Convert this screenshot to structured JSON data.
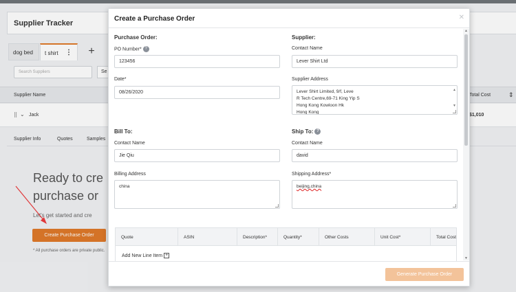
{
  "app": {
    "title": "Supplier Tracker",
    "tabs": [
      {
        "label": "dog bed"
      },
      {
        "label": "t shirt"
      }
    ],
    "add_tab_label": "+",
    "search": {
      "placeholder": "Search Suppliers",
      "button_label": "Se"
    },
    "table": {
      "columns": [
        "Supplier Name",
        "Total Cost"
      ],
      "rows": [
        {
          "name": "Jack",
          "total": "$1,010"
        }
      ]
    },
    "subtabs": [
      "Supplier Info",
      "Quotes",
      "Samples"
    ],
    "empty_state": {
      "heading_line1": "Ready to cre",
      "heading_line2": "purchase or",
      "subtext": "Let's get started and cre",
      "button_label": "Create Purchase Order",
      "note": "* All purchase orders are private public."
    }
  },
  "modal": {
    "title": "Create a Purchase Order",
    "close_icon": "close-icon",
    "purchase_order": {
      "section": "Purchase Order:",
      "po_label": "PO Number*",
      "po_value": "123456",
      "date_label": "Date*",
      "date_value": "08/26/2020"
    },
    "supplier": {
      "section": "Supplier:",
      "contact_label": "Contact Name",
      "contact_value": "Lever Shirt Ltd",
      "address_label": "Supplier Address",
      "address_lines": [
        "Lever Shirt Limited, 9/f, Leve",
        "R Tech Centre,69-71 King Yip S",
        "Hong Kong Kowloon Hk",
        "Hong Kong"
      ]
    },
    "bill_to": {
      "section": "Bill To:",
      "contact_label": "Contact Name",
      "contact_value": "Jie Qiu",
      "address_label": "Billing Address",
      "address_value": "china"
    },
    "ship_to": {
      "section": "Ship To:",
      "contact_label": "Contact Name",
      "contact_value": "david",
      "address_label": "Shipping Address*",
      "address_value": "beijing,china"
    },
    "line_items": {
      "columns": [
        "Quote",
        "ASIN",
        "Description*",
        "Quantity*",
        "Other Costs",
        "Unit Cost*",
        "Total Cost"
      ],
      "add_label": "Add New Line Item"
    },
    "generate_button": "Generate Purchase Order"
  },
  "colors": {
    "accent": "#e07a2a",
    "accent_disabled": "#f3c39a",
    "arrow": "#e0383a"
  }
}
